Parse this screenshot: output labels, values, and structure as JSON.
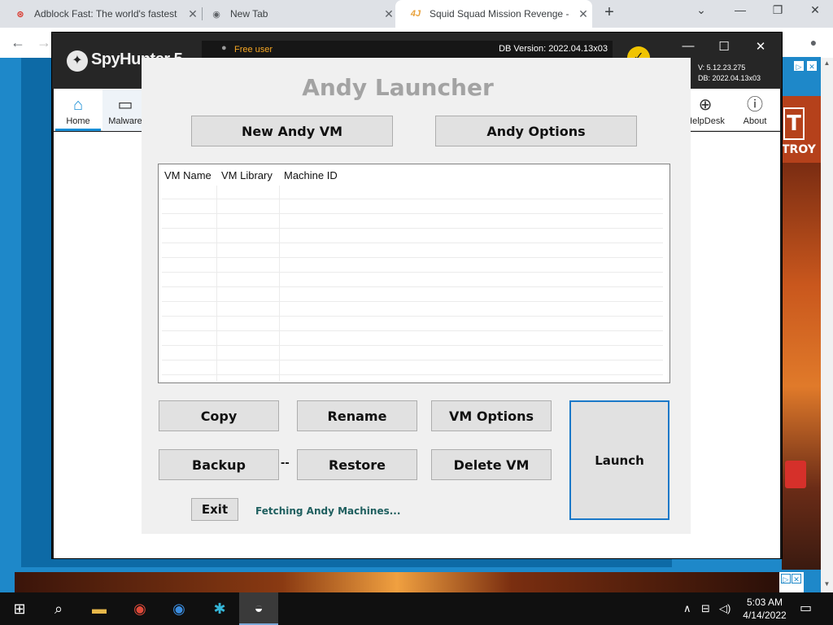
{
  "browser": {
    "tabs": [
      {
        "title": "Adblock Fast: The world's fastest",
        "icon": "adblock-icon"
      },
      {
        "title": "New Tab",
        "icon": "chrome-icon"
      },
      {
        "title": "Squid Squad Mission Revenge - ",
        "icon": "game-icon",
        "active": true
      }
    ],
    "new_tab_label": "+",
    "window_controls": {
      "dropdown": "⌄",
      "minimize": "—",
      "maximize": "❐",
      "close": "✕"
    },
    "nav": {
      "back": "←",
      "forward": "→"
    }
  },
  "ad": {
    "right_letter": "T",
    "right_word": "TROY",
    "close_labels": [
      "▷",
      "✕"
    ]
  },
  "spyhunter": {
    "logo_text": "SpyHunter 5",
    "user_label": "Free user",
    "db_version": "DB Version: 2022.04.13x03",
    "version_line1": "V: 5.12.23.275",
    "version_line2": "DB: 2022.04.13x03",
    "window_controls": {
      "minimize": "—",
      "maximize": "☐",
      "close": "✕"
    },
    "nav_items": [
      {
        "label": "Home",
        "icon": "home-icon"
      },
      {
        "label": "Malware",
        "icon": "malware-icon"
      },
      {
        "label": "HelpDesk",
        "icon": "helpdesk-icon"
      },
      {
        "label": "About",
        "icon": "about-icon"
      }
    ]
  },
  "andy": {
    "title": "Andy Launcher",
    "new_vm_label": "New Andy VM",
    "options_label": "Andy Options",
    "table": {
      "columns": [
        "VM Name",
        "VM Library",
        "Machine ID"
      ],
      "rows": []
    },
    "buttons": {
      "copy": "Copy",
      "rename": "Rename",
      "vm_options": "VM Options",
      "backup": "Backup",
      "restore": "Restore",
      "delete_vm": "Delete VM",
      "launch": "Launch",
      "exit": "Exit"
    },
    "separator": "--",
    "status": "Fetching Andy Machines..."
  },
  "taskbar": {
    "time": "5:03 AM",
    "date": "4/14/2022",
    "apps": [
      "start-icon",
      "search-icon",
      "file-explorer-icon",
      "chrome-icon",
      "chromium-icon",
      "app-icon",
      "andy-icon"
    ]
  }
}
